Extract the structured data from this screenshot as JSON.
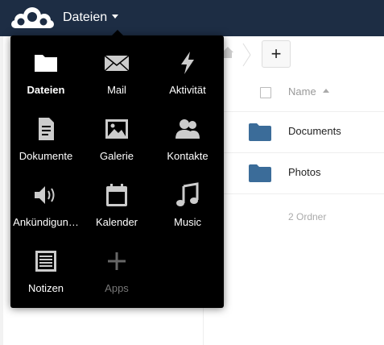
{
  "header": {
    "app_title": "Dateien"
  },
  "app_menu": {
    "items": [
      {
        "label": "Dateien",
        "icon": "folder-icon",
        "active": true
      },
      {
        "label": "Mail",
        "icon": "mail-icon"
      },
      {
        "label": "Aktivität",
        "icon": "lightning-icon"
      },
      {
        "label": "Dokumente",
        "icon": "document-icon"
      },
      {
        "label": "Galerie",
        "icon": "image-icon"
      },
      {
        "label": "Kontakte",
        "icon": "contacts-icon"
      },
      {
        "label": "Ankündigun…",
        "icon": "speaker-icon"
      },
      {
        "label": "Kalender",
        "icon": "calendar-icon"
      },
      {
        "label": "Music",
        "icon": "music-icon"
      },
      {
        "label": "Notizen",
        "icon": "notes-icon"
      },
      {
        "label": "Apps",
        "icon": "plus-icon"
      }
    ]
  },
  "controls": {
    "new_label": "+"
  },
  "filelist": {
    "column_name": "Name",
    "rows": [
      {
        "name": "Documents",
        "icon": "folder-icon"
      },
      {
        "name": "Photos",
        "icon": "folder-icon"
      }
    ],
    "summary": "2 Ordner"
  },
  "colors": {
    "header_bg": "#1d2d44",
    "folder_blue": "#3b6c99",
    "menu_bg": "#000000"
  }
}
